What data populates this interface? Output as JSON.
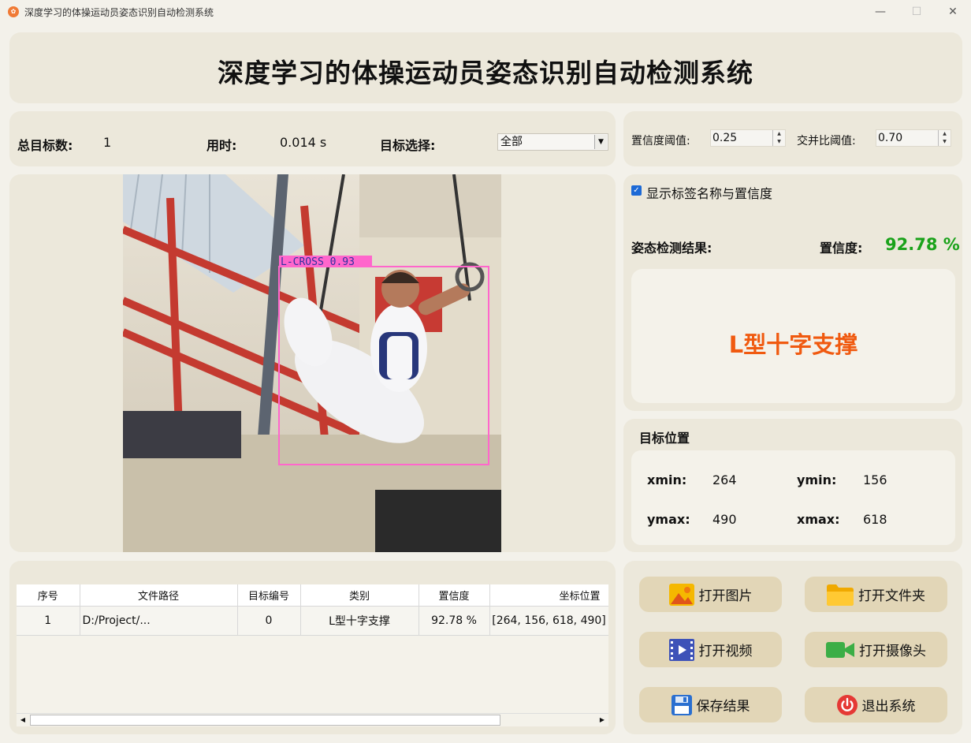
{
  "window": {
    "title": "深度学习的体操运动员姿态识别自动检测系统",
    "minimize": "—",
    "maximize": "☐",
    "close": "✕"
  },
  "header": {
    "title": "深度学习的体操运动员姿态识别自动检测系统"
  },
  "stats": {
    "total_label": "总目标数:",
    "total_value": "1",
    "time_label": "用时:",
    "time_value": "0.014 s",
    "select_label": "目标选择:",
    "select_value": "全部"
  },
  "thresholds": {
    "conf_label": "置信度阈值:",
    "conf_value": "0.25",
    "iou_label": "交并比阈值:",
    "iou_value": "0.70"
  },
  "detection_overlay": {
    "label": "L-CROSS 0.93"
  },
  "result": {
    "show_label_text": "显示标签名称与置信度",
    "show_label_checked": true,
    "pose_label": "姿态检测结果:",
    "confidence_label": "置信度:",
    "confidence_value": "92.78 %",
    "class_name": "L型十字支撑"
  },
  "position": {
    "title": "目标位置",
    "xmin_label": "xmin:",
    "xmin_value": "264",
    "ymin_label": "ymin:",
    "ymin_value": "156",
    "ymax_label": "ymax:",
    "ymax_value": "490",
    "xmax_label": "xmax:",
    "xmax_value": "618"
  },
  "table": {
    "headers": [
      "序号",
      "文件路径",
      "目标编号",
      "类别",
      "置信度",
      "坐标位置"
    ],
    "rows": [
      [
        "1",
        "D:/Project/...",
        "0",
        "L型十字支撑",
        "92.78 %",
        "[264, 156, 618, 490]"
      ]
    ]
  },
  "buttons": {
    "open_image": "打开图片",
    "open_folder": "打开文件夹",
    "open_video": "打开视频",
    "open_camera": "打开摄像头",
    "save_result": "保存结果",
    "exit": "退出系统"
  },
  "colors": {
    "background": "#f3f1ea",
    "panel": "#ece8db",
    "button": "#e2d6b7",
    "confidence": "#1aa21a",
    "class_name": "#f05a10",
    "bbox": "#ff66cc"
  }
}
